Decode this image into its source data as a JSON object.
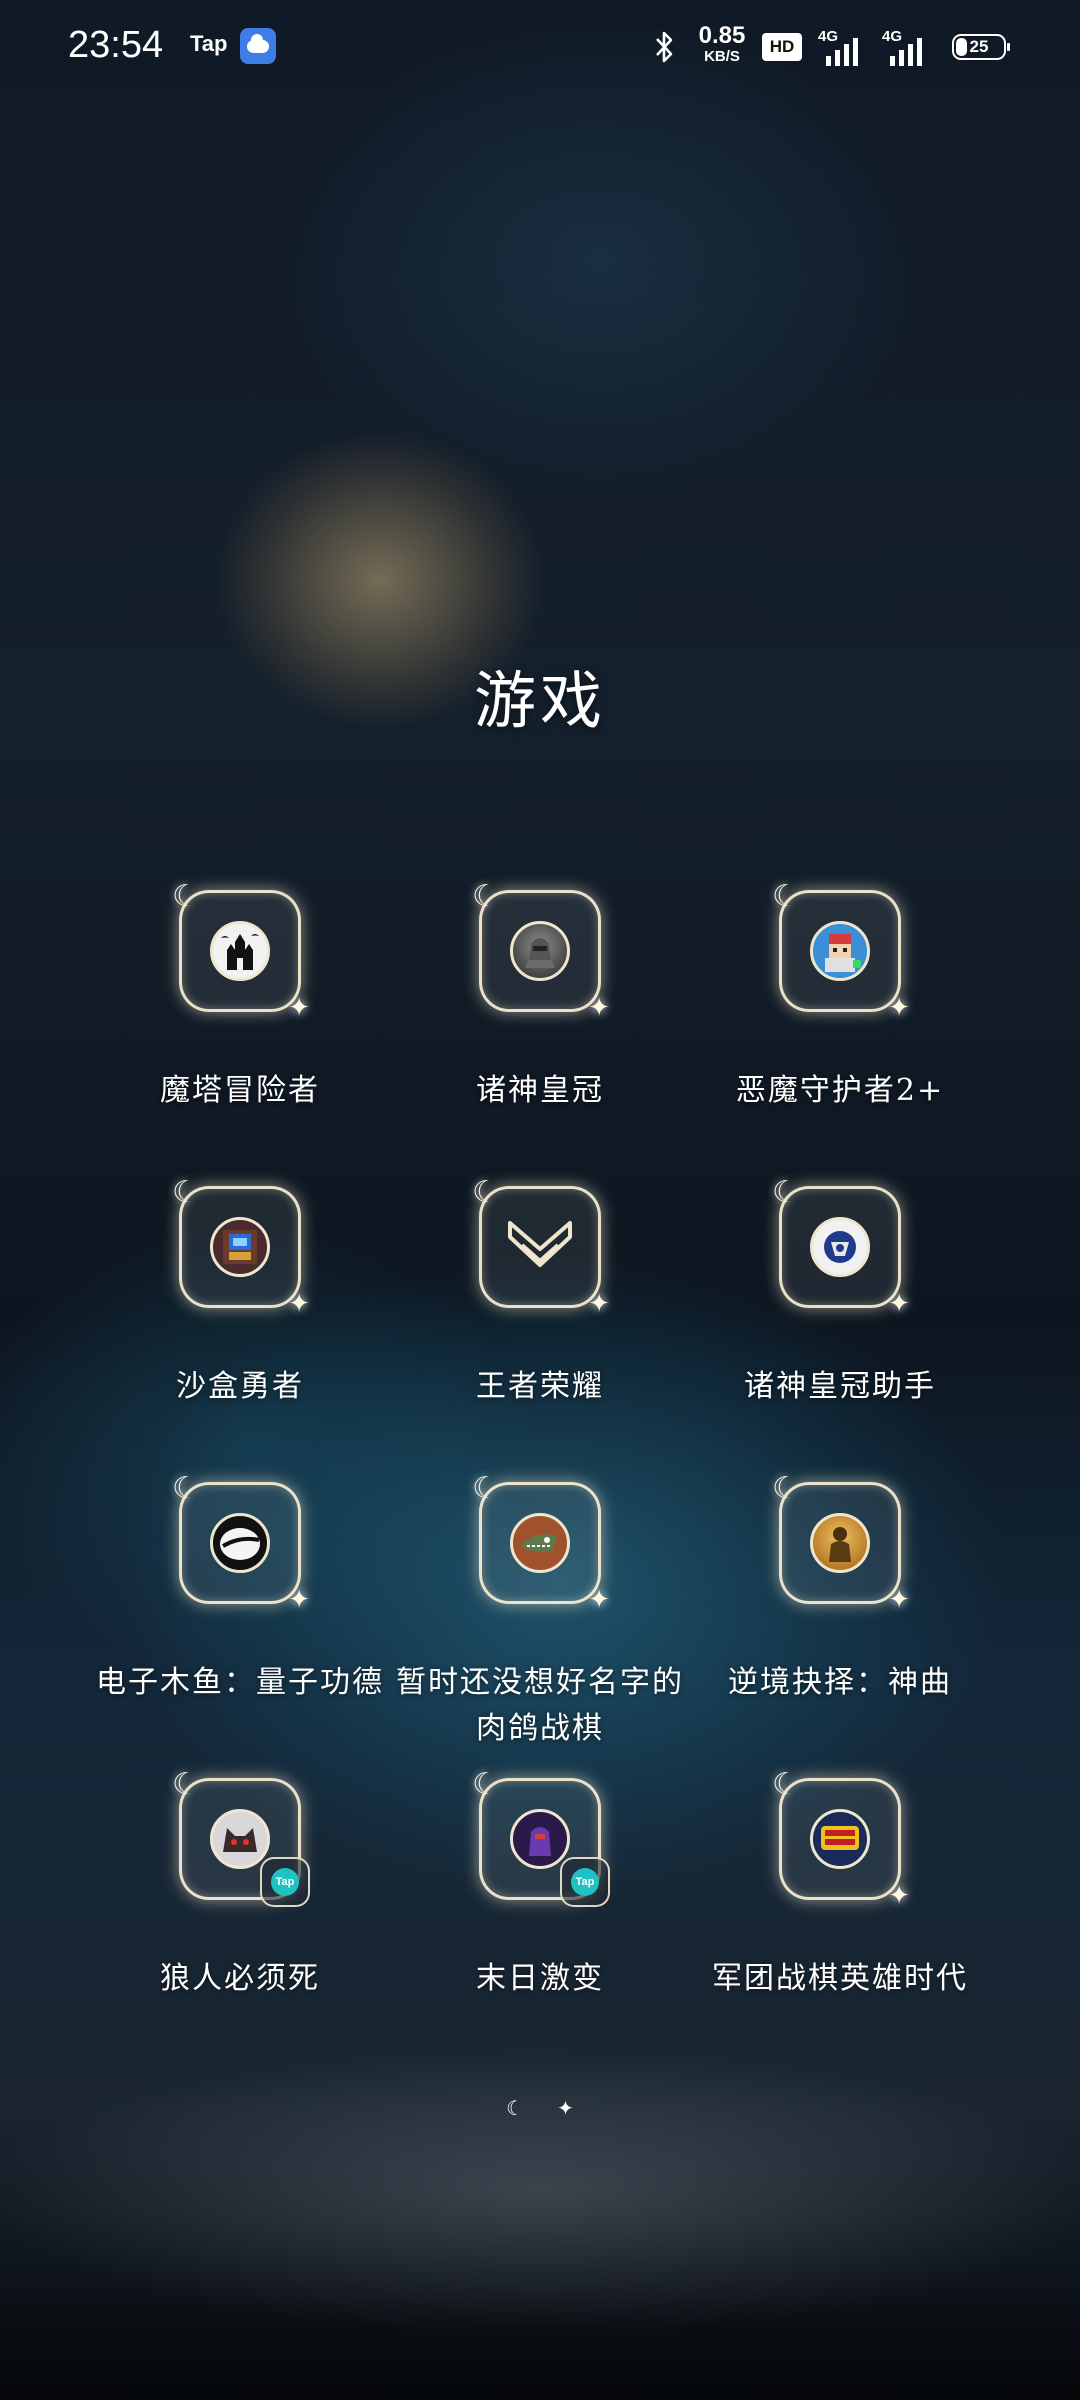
{
  "status_bar": {
    "time": "23:54",
    "tap_label": "Tap",
    "network_speed": "0.85",
    "network_speed_unit": "KB/S",
    "hd_label": "HD",
    "signal_1_label": "4G",
    "signal_2_label": "4G",
    "battery_level": "25"
  },
  "folder": {
    "title": "游戏"
  },
  "apps": [
    {
      "label": "魔塔冒险者",
      "icon": "haunted-castle-icon",
      "tap_badge": false
    },
    {
      "label": "诸神皇冠",
      "icon": "armored-warrior-icon",
      "tap_badge": false
    },
    {
      "label": "恶魔守护者2+",
      "icon": "pixel-character-icon",
      "tap_badge": false
    },
    {
      "label": "沙盒勇者",
      "icon": "pixel-robot-icon",
      "tap_badge": false
    },
    {
      "label": "王者荣耀",
      "icon": "chevron-emblem-icon",
      "tap_badge": false
    },
    {
      "label": "诸神皇冠助手",
      "icon": "helper-emblem-icon",
      "tap_badge": false
    },
    {
      "label": "电子木鱼：量子功德",
      "icon": "wooden-fish-icon",
      "tap_badge": false
    },
    {
      "label": "暂时还没想好名字的肉鸽战棋",
      "icon": "crocodile-warrior-icon",
      "tap_badge": false
    },
    {
      "label": "逆境抉择：神曲",
      "icon": "golden-knight-icon",
      "tap_badge": false
    },
    {
      "label": "狼人必须死",
      "icon": "werewolf-icon",
      "tap_badge": true
    },
    {
      "label": "末日激变",
      "icon": "purple-mech-icon",
      "tap_badge": true
    },
    {
      "label": "军团战棋英雄时代",
      "icon": "legion-chess-icon",
      "tap_badge": false
    }
  ],
  "tap_badge_label": "Tap",
  "page_indicator": {
    "pages": 2,
    "current": 1
  }
}
